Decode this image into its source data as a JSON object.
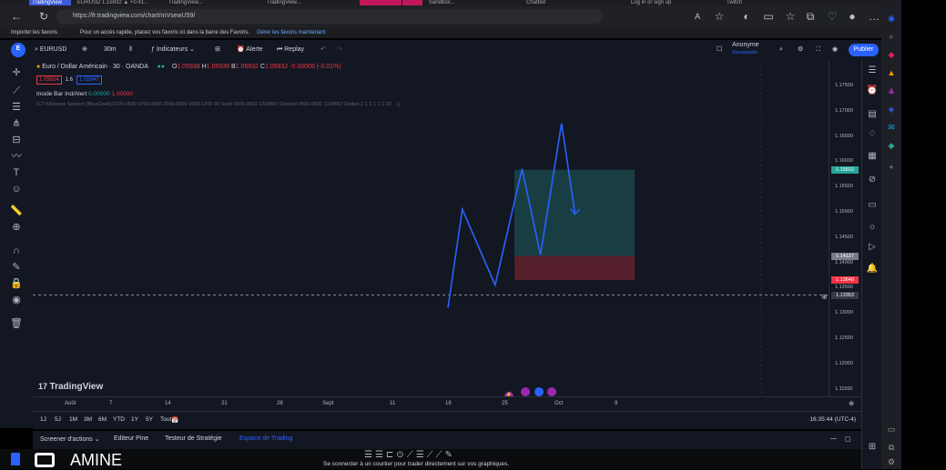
{
  "browser": {
    "tabs": [
      "TradingView",
      "EURUSD 1.15932 ▲ +0.41...",
      "TradingView...",
      "TradingView...",
      "",
      "",
      "Sandbox...",
      "Chatbot",
      "Log in or sign up",
      "Twitch"
    ],
    "url": "https://fr.tradingview.com/chart/mVsewU59/",
    "favorites_bar": {
      "import": "Importer les favoris",
      "text": "Pour un accès rapide, placez vos favoris ici dans la barre des Favoris.",
      "link": "Gérer les favoris maintenant"
    }
  },
  "toolbar": {
    "symbol": "EURUSD",
    "interval": "30m",
    "indicators": "Indicateurs",
    "alert": "Alerte",
    "replay": "Replay",
    "account": "Anonyme",
    "account_sub": "Sauvegarder",
    "publish": "Publier"
  },
  "legend": {
    "title": "Euro / Dollar Américain · 30 · OANDA",
    "o_label": "O",
    "o": "1.05938",
    "h_label": "H",
    "h": "1.05939",
    "b_label": "B",
    "b": "1.05932",
    "c_label": "C",
    "c": "1.05932",
    "change": "-0.00006 (-0.01%)",
    "sell": "1.05924",
    "spread": "1.6",
    "buy": "1.05947",
    "indicator1": "Inside Bar Ind/Alert",
    "indicator1_v1": "0.00000",
    "indicator1_v2": "1.00000",
    "indicator2": "ICT Killzones Session [BlueGeek] 0200-0500 0700-0900 2000-0000 1000-1200 90 Solid 0000-0001 1234567 Dashed 0830-0831 1234567 Dotted 2 1 1 1 1 1 20"
  },
  "price_axis": {
    "labels": [
      "1.17500",
      "1.17000",
      "1.16500",
      "1.16000",
      "1.15500",
      "1.15000",
      "1.14500",
      "1.14000",
      "1.13500",
      "1.13000",
      "1.12500",
      "1.12000",
      "1.11500"
    ],
    "badges": [
      {
        "text": "1.15832",
        "color": "#26a69a"
      },
      {
        "text": "1.14127",
        "color": "#787b86"
      },
      {
        "text": "1.13648",
        "color": "#f23645"
      },
      {
        "text": "1.13353",
        "color": "#363a45"
      }
    ]
  },
  "time_axis": {
    "labels": [
      "Août",
      "7",
      "14",
      "21",
      "28",
      "Sept",
      "11",
      "18",
      "25",
      "Oct",
      "9"
    ]
  },
  "ranges": [
    "1J",
    "5J",
    "1M",
    "3M",
    "6M",
    "YTD",
    "1Y",
    "5Y",
    "Tout"
  ],
  "clock": "16:35:44 (UTC-4)",
  "logo": "TradingView",
  "bottom_tabs": [
    "Screener d'actions",
    "Editeur Pine",
    "Testeur de Stratégie",
    "Espace de Trading"
  ],
  "status_message": "Se connecter à un courtier pour trader directement sur vos graphiques.",
  "overlay_name": "AMINE",
  "chart_data": {
    "type": "line",
    "x_axis": [
      "Août",
      "7",
      "14",
      "21",
      "28",
      "Sept",
      "11",
      "18",
      "25",
      "Oct",
      "9"
    ],
    "ylim": [
      1.115,
      1.175
    ],
    "series": [
      {
        "x": [
          "11",
          "13",
          "18",
          "22",
          "25",
          "28",
          "30"
        ],
        "values": [
          1.131,
          1.1505,
          1.1355,
          1.1585,
          1.1415,
          1.1675,
          1.1495
        ]
      }
    ],
    "position_tool": {
      "entry": 1.14127,
      "target": 1.15832,
      "stop": 1.13648
    },
    "crosshair_price": 1.13353,
    "colors": {
      "line": "#2962ff",
      "profit": "#26a69a",
      "loss": "#f23645"
    }
  }
}
